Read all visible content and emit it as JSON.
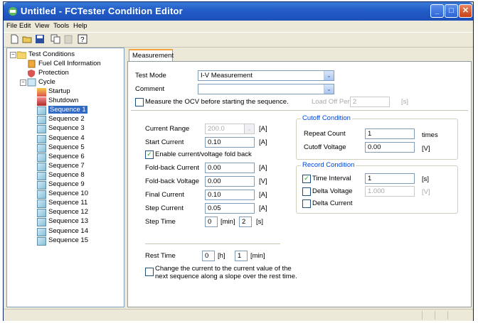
{
  "window": {
    "title": "Untitled - FCTester Condition Editor",
    "min_glyph": "_",
    "max_glyph": "□",
    "close_glyph": "✕"
  },
  "menu": [
    "File",
    "Edit",
    "View",
    "Tools",
    "Help"
  ],
  "toolbar": {
    "icons": [
      "new-file-icon",
      "open-folder-icon",
      "save-icon",
      "copy-icon",
      "paste-icon",
      "help-icon"
    ],
    "help_glyph": "?"
  },
  "tree": {
    "root": "Test Conditions",
    "children": [
      "Fuel Cell Information",
      "Protection",
      "Cycle"
    ],
    "cycle_children": [
      "Startup",
      "Shutdown",
      "Sequence 1",
      "Sequence 2",
      "Sequence 3",
      "Sequence 4",
      "Sequence 5",
      "Sequence 6",
      "Sequence 7",
      "Sequence 8",
      "Sequence 9",
      "Sequence 10",
      "Sequence 11",
      "Sequence 12",
      "Sequence 13",
      "Sequence 14",
      "Sequence 15"
    ],
    "selected": "Sequence 1"
  },
  "tab": {
    "label": "Measurement"
  },
  "form": {
    "test_mode_label": "Test Mode",
    "test_mode_value": "I-V Measurement",
    "comment_label": "Comment",
    "comment_value": "",
    "ocv_label": "Measure the OCV before starting the sequence.",
    "ocv_checked": false,
    "load_off_label": "Load Off Period",
    "load_off_value": "2",
    "load_off_unit": "[s]",
    "current_range_label": "Current Range",
    "current_range_value": "200.0",
    "current_range_unit": "[A]",
    "start_current_label": "Start Current",
    "start_current_value": "0.10",
    "start_current_unit": "[A]",
    "foldback_enable_label": "Enable current/voltage fold back",
    "foldback_enable_checked": true,
    "foldback_current_label": "Fold-back Current",
    "foldback_current_value": "0.00",
    "foldback_current_unit": "[A]",
    "foldback_voltage_label": "Fold-back Voltage",
    "foldback_voltage_value": "0.00",
    "foldback_voltage_unit": "[V]",
    "final_current_label": "Final Current",
    "final_current_value": "0.10",
    "final_current_unit": "[A]",
    "step_current_label": "Step Current",
    "step_current_value": "0.05",
    "step_current_unit": "[A]",
    "step_time_label": "Step Time",
    "step_time_min_value": "0",
    "step_time_min_unit": "[min]",
    "step_time_sec_value": "2",
    "step_time_sec_unit": "[s]",
    "rest_time_label": "Rest Time",
    "rest_time_h_value": "0",
    "rest_time_h_unit": "[h]",
    "rest_time_min_value": "1",
    "rest_time_min_unit": "[min]",
    "change_current_label_1": "Change the current to the current value of the",
    "change_current_label_2": "next sequence along a slope over the rest time.",
    "change_current_checked": false
  },
  "cutoff": {
    "title": "Cutoff Condition",
    "repeat_count_label": "Repeat Count",
    "repeat_count_value": "1",
    "repeat_count_unit": "times",
    "cutoff_voltage_label": "Cutoff Voltage",
    "cutoff_voltage_value": "0.00",
    "cutoff_voltage_unit": "[V]"
  },
  "record": {
    "title": "Record Condition",
    "time_interval_label": "Time Interval",
    "time_interval_checked": true,
    "time_interval_value": "1",
    "time_interval_unit": "[s]",
    "delta_voltage_label": "Delta Voltage",
    "delta_voltage_checked": false,
    "delta_voltage_value": "1.000",
    "delta_voltage_unit": "[V]",
    "delta_current_label": "Delta Current",
    "delta_current_checked": false
  },
  "glyphs": {
    "check": "✓",
    "dropdown": "⌄",
    "minus": "−",
    "collapse": "−"
  },
  "colors": {
    "title_bar": "#245ec9",
    "selection": "#316ac5",
    "group_title": "#0046d5",
    "tab_accent": "#f4a23a"
  }
}
